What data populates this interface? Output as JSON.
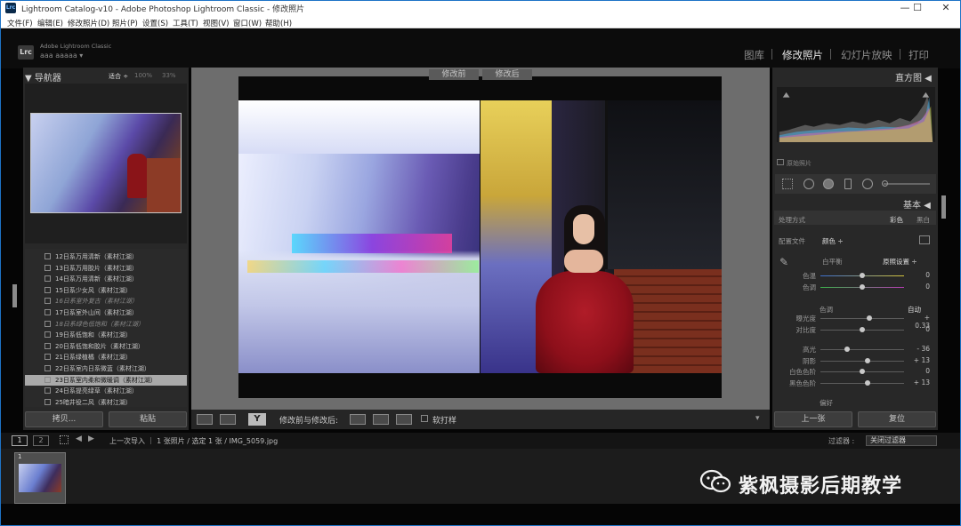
{
  "window": {
    "app_icon": "Lrc",
    "title": "Lightroom Catalog-v10 - Adobe Photoshop Lightroom Classic - 修改照片",
    "controls": [
      "—",
      "☐",
      "✕"
    ]
  },
  "menu": [
    "文件(F)",
    "编辑(E)",
    "修改照片(D)",
    "照片(P)",
    "设置(S)",
    "工具(T)",
    "视图(V)",
    "窗口(W)",
    "帮助(H)"
  ],
  "identity": {
    "badge": "Lrc",
    "product": "Adobe Lightroom Classic",
    "user": "aaa aaaaa"
  },
  "modules": [
    "图库",
    "修改照片",
    "幻灯片放映",
    "打印"
  ],
  "active_module": "修改照片",
  "navigator": {
    "title": "导航器",
    "zoom_fit": "适合",
    "zoom_100": "100%",
    "zoom_33": "33%"
  },
  "collections": [
    {
      "label": "12日系万用清新（素材江湖）",
      "style": "normal"
    },
    {
      "label": "13日系万用胶片（素材江湖）",
      "style": "normal"
    },
    {
      "label": "14日系万用清新（素材江湖）",
      "style": "normal"
    },
    {
      "label": "15日系少女风（素材江湖）",
      "style": "normal"
    },
    {
      "label": "16日系室外复古（素材江湖）",
      "style": "italic"
    },
    {
      "label": "17日系室外山间（素材江湖）",
      "style": "normal"
    },
    {
      "label": "18日系绿色低饱和（素材江湖）",
      "style": "italic"
    },
    {
      "label": "19日系低饱和（素材江湖）",
      "style": "normal"
    },
    {
      "label": "20日系低饱和胶片（素材江湖）",
      "style": "normal"
    },
    {
      "label": "21日系绿植橘（素材江湖）",
      "style": "normal"
    },
    {
      "label": "22日系室内日系微蓝（素材江湖）",
      "style": "normal"
    },
    {
      "label": "23日系室内柔和微暖调（素材江湖）",
      "style": "selected"
    },
    {
      "label": "24日系提亮绿草（素材江湖）",
      "style": "normal"
    },
    {
      "label": "25暗井役二风（素材江湖）",
      "style": "normal"
    }
  ],
  "left_buttons": {
    "copy": "拷贝...",
    "paste": "粘贴"
  },
  "before_after": {
    "before": "修改前",
    "after": "修改后"
  },
  "toolbar": {
    "label": "修改前与修改后:",
    "softproof": "软打样",
    "view_mode": "Y"
  },
  "right": {
    "histogram_title": "直方图",
    "original_photo": "原始照片",
    "basic_title": "基本",
    "treatment_label": "处理方式",
    "treatment_color": "彩色",
    "treatment_bw": "黑白",
    "profile_label": "配置文件",
    "profile_value": "颜色",
    "wb_label": "白平衡",
    "wb_value": "原照设置",
    "tone_label": "色调",
    "tone_auto": "自动",
    "sliders": [
      {
        "label": "色温",
        "value": "0",
        "pos": 0.5
      },
      {
        "label": "色调",
        "value": "0",
        "pos": 0.5
      },
      {
        "label": "曝光度",
        "value": "+ 0.33",
        "pos": 0.58
      },
      {
        "label": "对比度",
        "value": "0",
        "pos": 0.5
      },
      {
        "label": "高光",
        "value": "- 36",
        "pos": 0.32
      },
      {
        "label": "阴影",
        "value": "+ 13",
        "pos": 0.56
      },
      {
        "label": "白色色阶",
        "value": "0",
        "pos": 0.5
      },
      {
        "label": "黑色色阶",
        "value": "+ 13",
        "pos": 0.56
      }
    ],
    "presence": "偏好",
    "prev_button": "上一张",
    "reset_button": "复位"
  },
  "filmstrip": {
    "page1": "1",
    "page2": "2",
    "breadcrumb": "上一次导入 ｜ 1 张照片 / 选定 1 张 / IMG_5059.jpg",
    "filter_label": "过滤器 :",
    "filter_value": "关闭过滤器",
    "thumb_index": "1"
  },
  "watermark": "紫枫摄影后期教学"
}
